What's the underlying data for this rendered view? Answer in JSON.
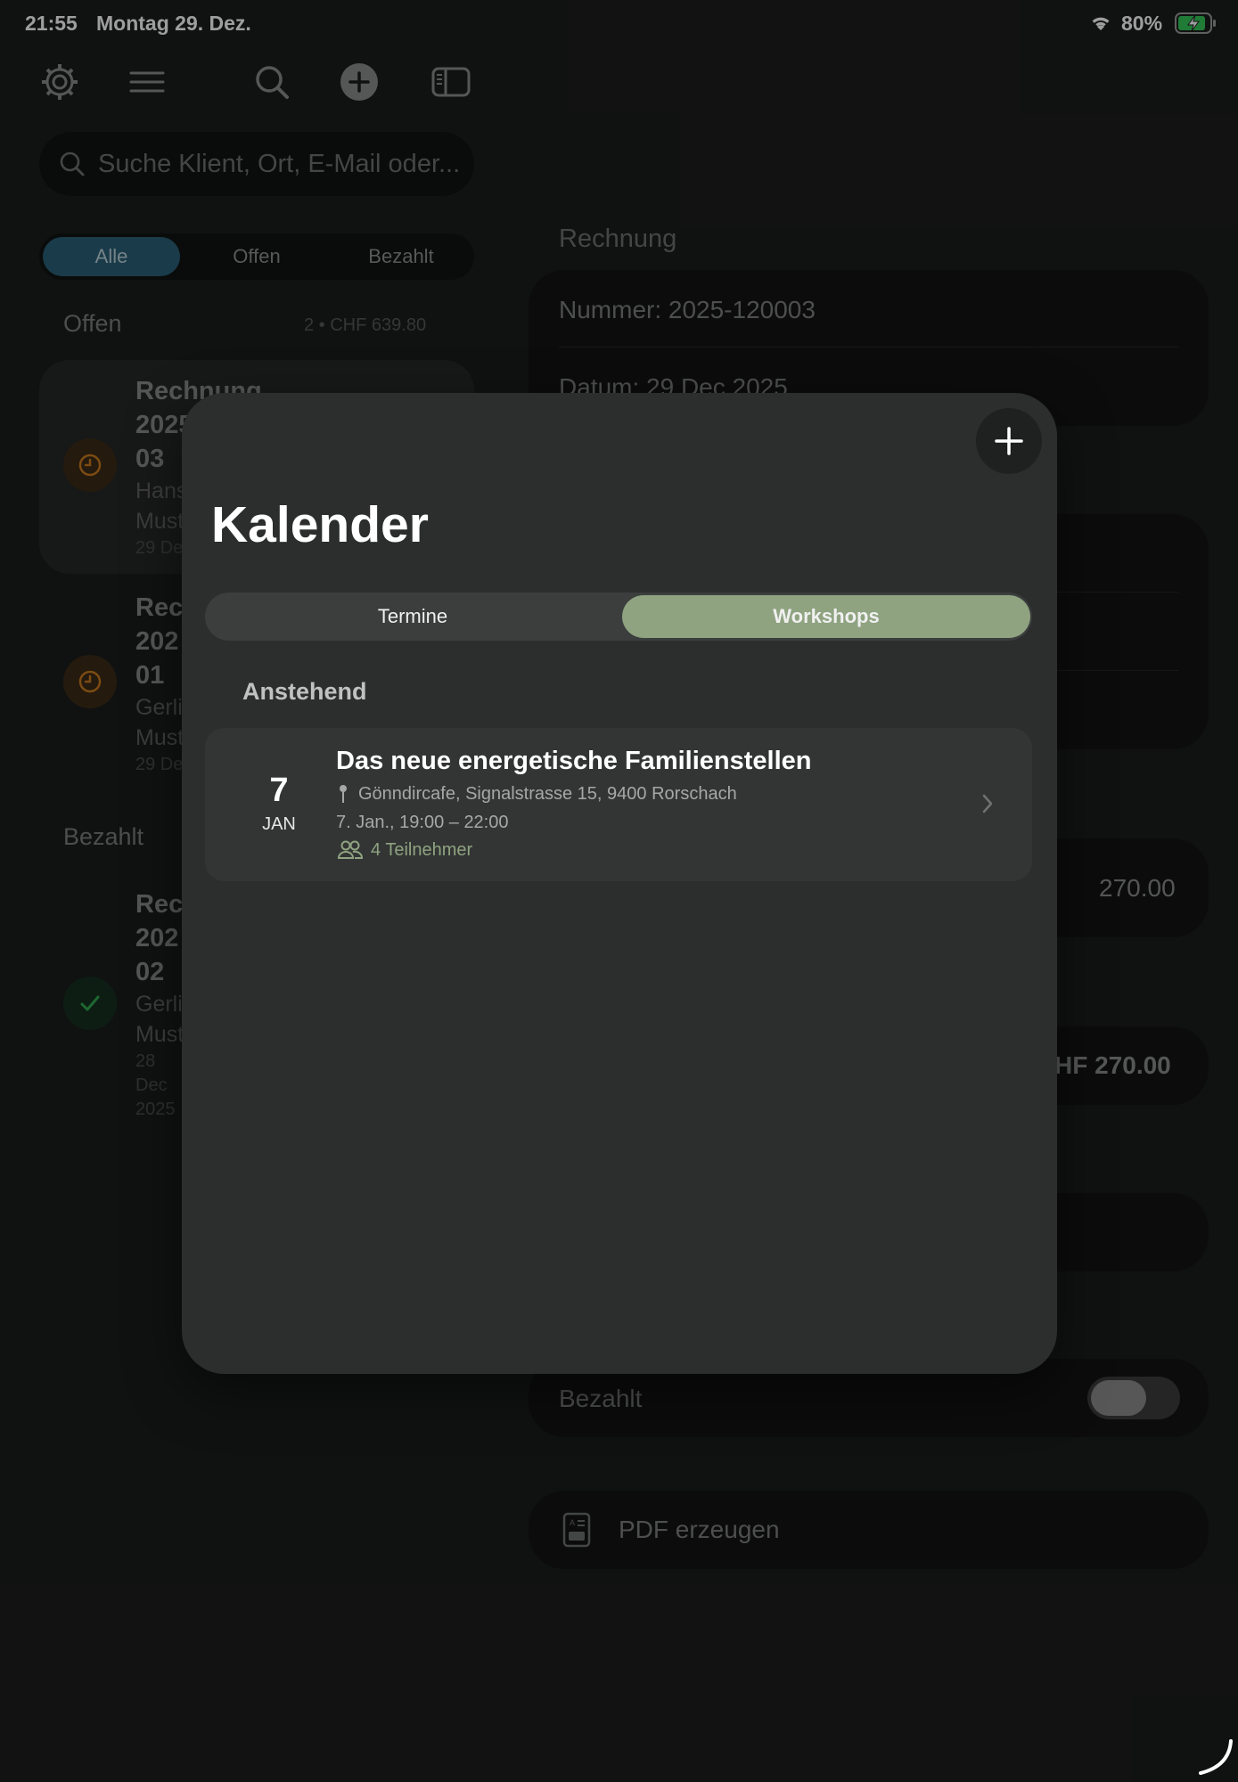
{
  "status_bar": {
    "time": "21:55",
    "date": "Montag 29. Dez.",
    "battery_percent": "80%"
  },
  "toolbar": {
    "icons": [
      "settings-icon",
      "menu-icon",
      "search-icon",
      "add-icon",
      "sidebar-icon"
    ]
  },
  "sidebar": {
    "search_placeholder": "Suche Klient, Ort, E-Mail oder...",
    "filter": {
      "options": [
        "Alle",
        "Offen",
        "Bezahlt"
      ],
      "selected": "Alle"
    },
    "open_section": {
      "title": "Offen",
      "meta": "2 • CHF 639.80",
      "items": [
        {
          "title_lines": [
            "Rechnung",
            "2025",
            "03"
          ],
          "client_lines": [
            "Hans",
            "Must"
          ],
          "date": "29 De"
        },
        {
          "title_lines": [
            "Rec",
            "202",
            "01"
          ],
          "client_lines": [
            "Gerli",
            "Must"
          ],
          "date": "29 De"
        }
      ]
    },
    "paid_section": {
      "title": "Bezahlt",
      "items": [
        {
          "title_lines": [
            "Rec",
            "202",
            "02"
          ],
          "client_lines": [
            "Gerli",
            "Must"
          ],
          "date_lines": [
            "28",
            "Dec",
            "2025"
          ]
        }
      ]
    }
  },
  "detail": {
    "section_title": "Rechnung",
    "number": "Nummer: 2025-120003",
    "date": "Datum: 29 Dec 2025",
    "amount_partial": "270.00",
    "total_partial": "HF 270.00",
    "paid_label": "Bezahlt",
    "pdf_label": "PDF erzeugen"
  },
  "modal": {
    "title": "Kalender",
    "tabs": [
      "Termine",
      "Workshops"
    ],
    "selected_tab": "Workshops",
    "section": "Anstehend",
    "events": [
      {
        "day": "7",
        "month": "JAN",
        "title": "Das neue energetische Familienstellen",
        "location": "Gönndircafe, Signalstrasse 15, 9400 Rorschach",
        "time": "7. Jan., 19:00 – 22:00",
        "participants": "4 Teilnehmer"
      }
    ]
  },
  "colors": {
    "accent_blue": "#2a6076",
    "accent_green": "#8fa381",
    "pending_orange": "#c97a1e",
    "paid_green": "#2fa84f"
  }
}
